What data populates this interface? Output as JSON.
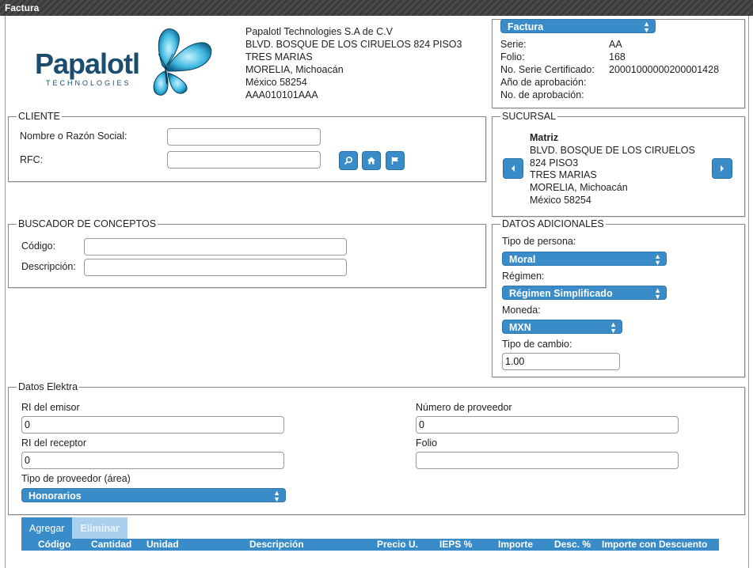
{
  "window": {
    "title": "Factura"
  },
  "company": {
    "logo_text": "Papalotl",
    "logo_subtext": "TECHNOLOGIES",
    "name": "Papalotl Technologies S.A de C.V",
    "street": "BLVD. BOSQUE DE LOS CIRUELOS 824 PISO3",
    "neighborhood": "TRES MARIAS",
    "city": "MORELIA, Michoacán",
    "country_zip": "México 58254",
    "rfc": "AAA010101AAA"
  },
  "invoice": {
    "type_selected": "Factura",
    "serie_label": "Serie:",
    "serie_value": "AA",
    "folio_label": "Folio:",
    "folio_value": "168",
    "cert_label": "No. Serie Certificado:",
    "cert_value": "20001000000200001428",
    "year_label": "Año de aprobación:",
    "approval_label": "No. de aprobación:"
  },
  "cliente": {
    "legend": "CLIENTE",
    "name_label": "Nombre o Razón Social:",
    "name_value": "",
    "rfc_label": "RFC:",
    "rfc_value": ""
  },
  "sucursal": {
    "legend": "SUCURSAL",
    "name": "Matriz",
    "street_1": "BLVD. BOSQUE DE LOS CIRUELOS",
    "street_2": "824 PISO3",
    "neighborhood": "TRES MARIAS",
    "city": "MORELIA, Michoacán",
    "country_zip": "México 58254"
  },
  "buscador": {
    "legend": "BUSCADOR DE CONCEPTOS",
    "code_label": "Código:",
    "code_value": "",
    "desc_label": "Descripción:",
    "desc_value": ""
  },
  "adicionales": {
    "legend": "DATOS ADICIONALES",
    "persona_label": "Tipo de persona:",
    "persona_value": "Moral",
    "regimen_label": "Régimen:",
    "regimen_value": "Régimen Simplificado",
    "moneda_label": "Moneda:",
    "moneda_value": "MXN",
    "cambio_label": "Tipo de cambio:",
    "cambio_value": "1.00"
  },
  "elektra": {
    "legend": "Datos Elektra",
    "ri_emisor_label": "RI del emisor",
    "ri_emisor_value": "0",
    "ri_receptor_label": "RI del receptor",
    "ri_receptor_value": "0",
    "proveedor_tipo_label": "Tipo de proveedor (área)",
    "proveedor_tipo_value": "Honorarios",
    "num_proveedor_label": "Número de proveedor",
    "num_proveedor_value": "0",
    "folio_label": "Folio",
    "folio_value": ""
  },
  "actions": {
    "add_label": "Agregar",
    "delete_label": "Eliminar"
  },
  "table": {
    "columns": [
      "Código",
      "Cantidad",
      "Unidad",
      "Descripción",
      "Precio U.",
      "IEPS %",
      "Importe",
      "Desc. %",
      "Importe con Descuento"
    ]
  },
  "colors": {
    "accent": "#3a8cc9",
    "disabled": "#a9d0ec",
    "titlebar": "#434343"
  },
  "icons": {
    "search": "search-icon",
    "home": "home-icon",
    "flag": "flag-icon",
    "prev": "chevron-left-icon",
    "next": "chevron-right-icon"
  }
}
